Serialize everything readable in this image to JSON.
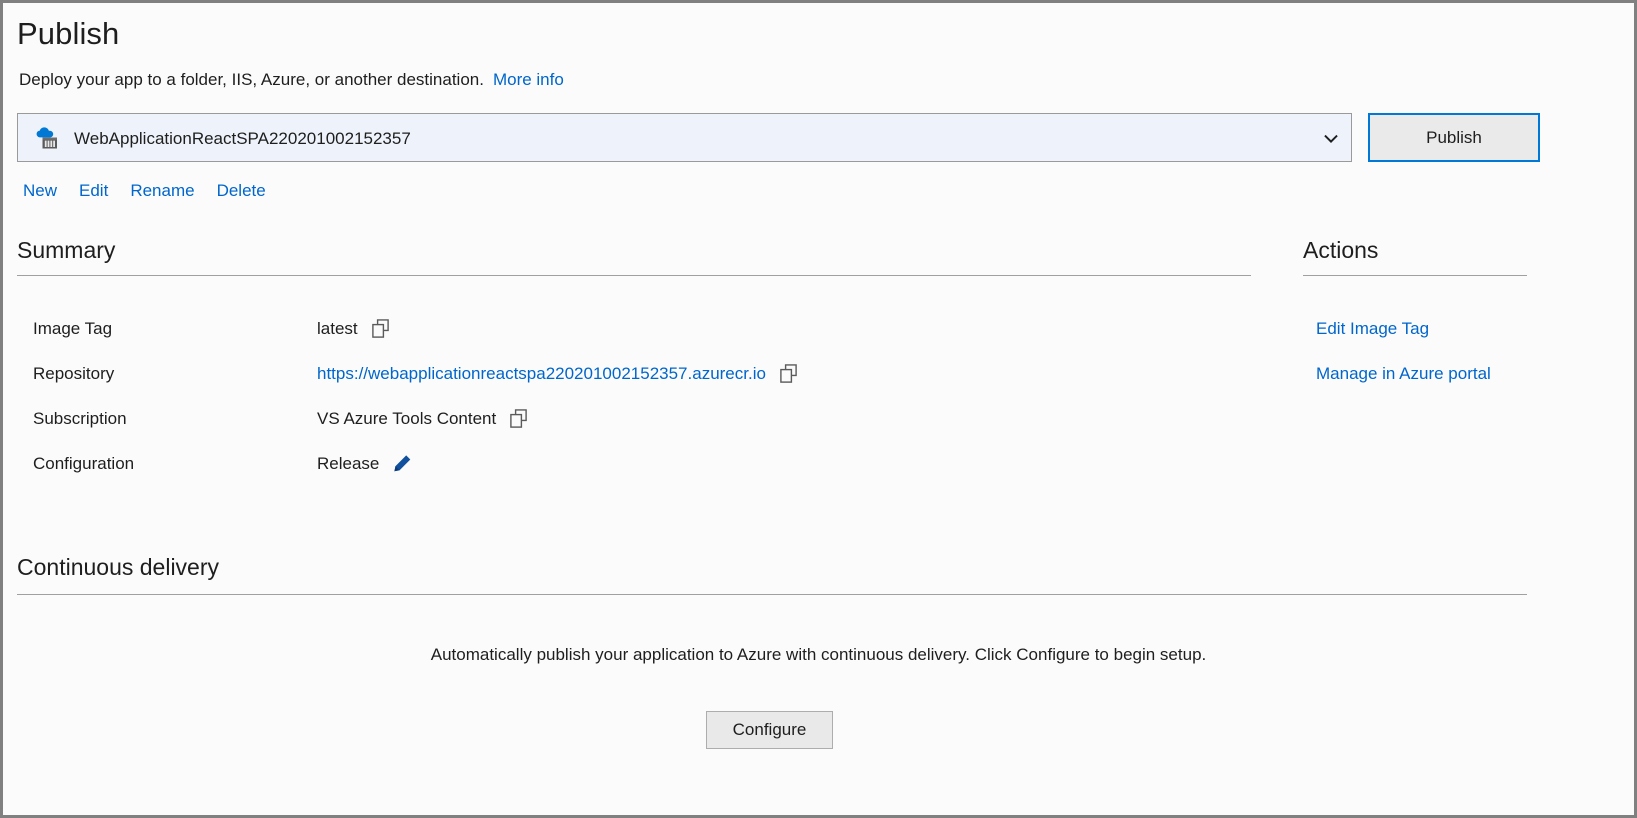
{
  "header": {
    "title": "Publish",
    "subtitle": "Deploy your app to a folder, IIS, Azure, or another destination.",
    "more_info_label": "More info"
  },
  "profile": {
    "selected": "WebApplicationReactSPA220201002152357",
    "icon": "azure-container-registry-icon",
    "chevron_icon": "chevron-down-icon",
    "publish_button_label": "Publish",
    "links": [
      {
        "label": "New",
        "name": "new-profile-link"
      },
      {
        "label": "Edit",
        "name": "edit-profile-link"
      },
      {
        "label": "Rename",
        "name": "rename-profile-link"
      },
      {
        "label": "Delete",
        "name": "delete-profile-link"
      }
    ]
  },
  "summary": {
    "heading": "Summary",
    "rows": [
      {
        "label": "Image Tag",
        "value": "latest",
        "is_link": false,
        "trailing_icon": "copy-icon"
      },
      {
        "label": "Repository",
        "value": "https://webapplicationreactspa220201002152357.azurecr.io",
        "is_link": true,
        "trailing_icon": "copy-icon"
      },
      {
        "label": "Subscription",
        "value": "VS Azure Tools Content",
        "is_link": false,
        "trailing_icon": "copy-icon"
      },
      {
        "label": "Configuration",
        "value": "Release",
        "is_link": false,
        "trailing_icon": "pencil-icon"
      }
    ]
  },
  "actions": {
    "heading": "Actions",
    "items": [
      {
        "label": "Edit Image Tag",
        "name": "edit-image-tag-action"
      },
      {
        "label": "Manage in Azure portal",
        "name": "manage-in-azure-portal-action"
      }
    ]
  },
  "continuous_delivery": {
    "heading": "Continuous delivery",
    "description": "Automatically publish your application to Azure with continuous delivery. Click Configure to begin setup.",
    "configure_button_label": "Configure"
  },
  "colors": {
    "link": "#0066cc",
    "accent_border": "#0078d7",
    "text": "#1e1e1e",
    "rule": "#a0a0a0",
    "combo_fill": "#eef3fb",
    "window_border": "#808080"
  }
}
